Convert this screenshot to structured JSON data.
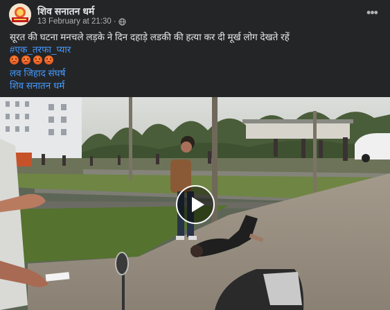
{
  "post": {
    "author": "शिव सनातन धर्म",
    "timestamp": "13 February at 21:30",
    "separator": "·",
    "privacy_icon": "globe-icon",
    "more_icon": "more-options-icon",
    "avatar_icon": "page-avatar"
  },
  "body": {
    "headline": "सूरत की घटना  मनचले लड़के ने दिन दहाड़े लडकी की हत्या कर दी मूर्ख लोग देखते रहें",
    "hashtag": "#एक_तरफा_प्यार",
    "emoji_count": 4,
    "emoji_icon": "angry-face-icon",
    "link1": "लव जिहाद संघर्ष",
    "link2": "शिव सनातन धर्म"
  },
  "video": {
    "play_icon": "play-icon"
  },
  "colors": {
    "background": "#242526",
    "text": "#e4e6eb",
    "secondary_text": "#b0b3b8",
    "link": "#4599ff"
  }
}
